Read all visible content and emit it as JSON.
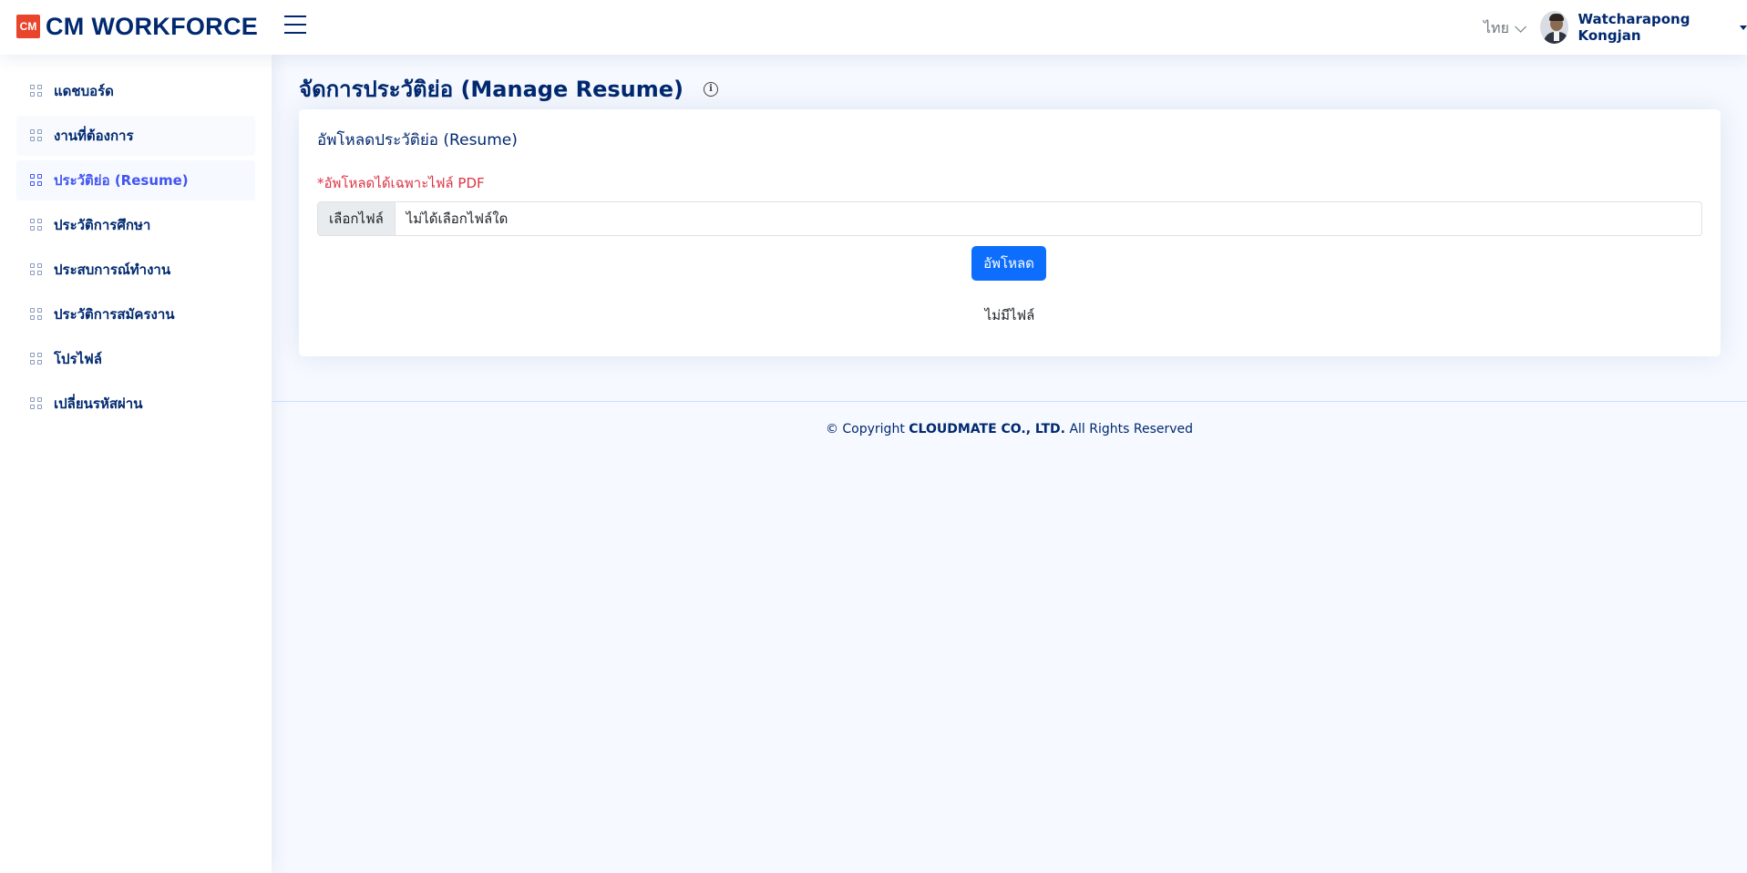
{
  "header": {
    "logo_mark": "CM",
    "logo_text": "CM WORKFORCE",
    "language": "ไทย",
    "user_name": "Watcharapong Kongjan"
  },
  "sidebar": {
    "items": [
      {
        "label": "แดชบอร์ด"
      },
      {
        "label": "งานที่ต้องการ"
      },
      {
        "label": "ประวัติย่อ (Resume)"
      },
      {
        "label": "ประวัติการศึกษา"
      },
      {
        "label": "ประสบการณ์ทำงาน"
      },
      {
        "label": "ประวัติการสมัครงาน"
      },
      {
        "label": "โปรไฟล์"
      },
      {
        "label": "เปลี่ยนรหัสผ่าน"
      }
    ]
  },
  "main": {
    "page_title": "จัดการประวัติย่อ (Manage Resume)",
    "card_title": "อัพโหลดประวัติย่อ (Resume)",
    "note": "*อัพโหลดได้เฉพาะไฟล์ PDF",
    "file_button": "เลือกไฟล์",
    "file_status": "ไม่ได้เลือกไฟล์ใด",
    "upload_button": "อัพโหลด",
    "no_file": "ไม่มีไฟล์"
  },
  "footer": {
    "prefix": "© Copyright",
    "company": "CLOUDMATE CO., LTD.",
    "suffix": "All Rights Reserved"
  },
  "colors": {
    "brand_red": "#e8452c",
    "navy": "#012970",
    "active_blue": "#4154f1",
    "primary_button": "#0d6efd",
    "warning_text": "#dc3545"
  }
}
